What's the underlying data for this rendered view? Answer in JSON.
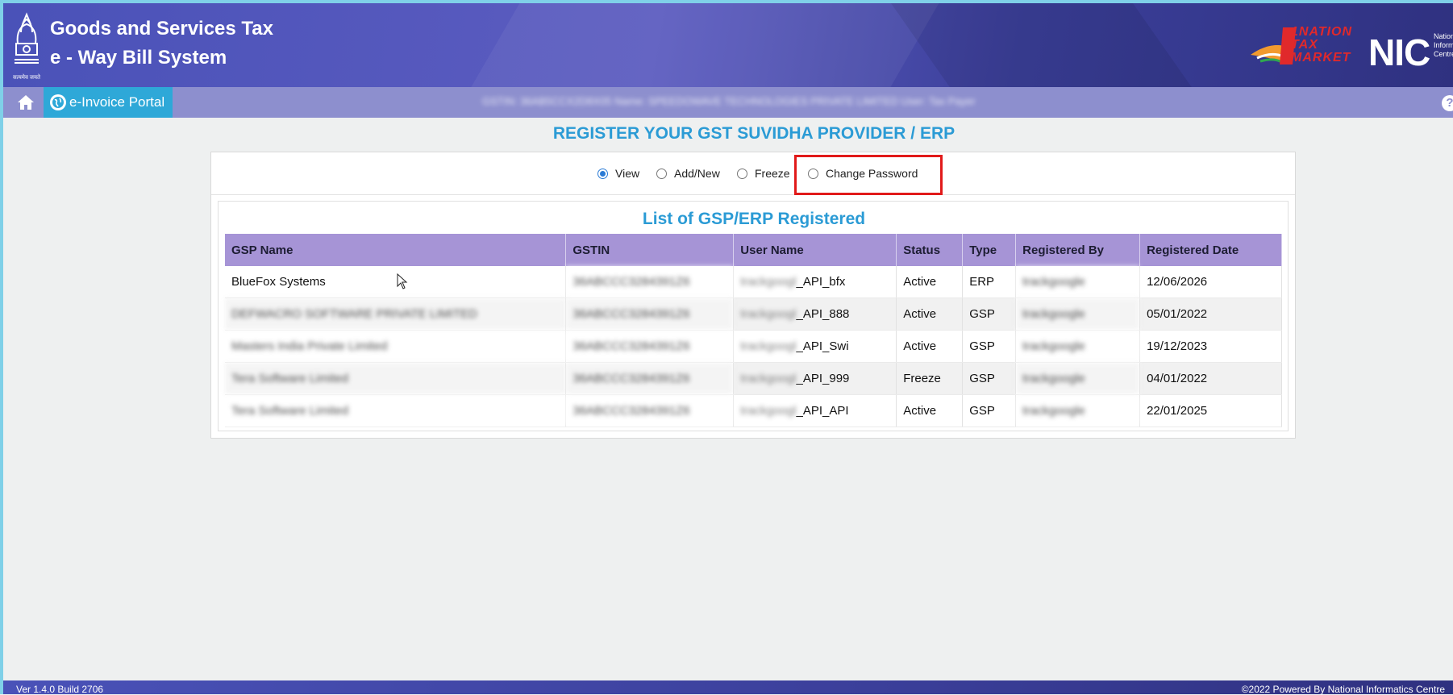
{
  "header": {
    "title_line1": "Goods and Services Tax",
    "title_line2": "e - Way Bill System",
    "emblem_caption": "सत्यमेव जयते",
    "logo_1nation": "1NATION TAX MARKET",
    "logo_nic": "NIC",
    "logo_nic_sub": "National Informatics Centre"
  },
  "nav": {
    "home_icon": "home-icon",
    "portal_label": "e-Invoice Portal",
    "user_info": "GSTIN: 36AB5CCX2D8X05 Name: SPEEDOWAVE TECHNOLOGIES PRIVATE LIMITED User: Tax Payer",
    "help_icon": "?"
  },
  "main": {
    "page_title": "REGISTER YOUR GST SUVIDHA PROVIDER / ERP",
    "options": [
      {
        "label": "View",
        "checked": true
      },
      {
        "label": "Add/New",
        "checked": false
      },
      {
        "label": "Freeze",
        "checked": false
      },
      {
        "label": "Change Password",
        "checked": false
      }
    ],
    "list_title": "List of GSP/ERP Registered",
    "columns": [
      "GSP Name",
      "GSTIN",
      "User Name",
      "Status",
      "Type",
      "Registered By",
      "Registered Date"
    ],
    "rows": [
      {
        "name": "BlueFox Systems",
        "gstin": "36ABCCC3284391Z6",
        "username_prefix": "trackgoogl",
        "username_suffix": "_API_bfx",
        "status": "Active",
        "type": "ERP",
        "registered_by": "trackgoogle",
        "date": "12/06/2026"
      },
      {
        "name": "DEFWACRO SOFTWARE PRIVATE LIMITED",
        "gstin": "36ABCCC3284391Z6",
        "username_prefix": "trackgoogl",
        "username_suffix": "_API_888",
        "status": "Active",
        "type": "GSP",
        "registered_by": "trackgoogle",
        "date": "05/01/2022"
      },
      {
        "name": "Masters India Private Limited",
        "gstin": "36ABCCC3284391Z6",
        "username_prefix": "trackgoogl",
        "username_suffix": "_API_Swi",
        "status": "Active",
        "type": "GSP",
        "registered_by": "trackgoogle",
        "date": "19/12/2023"
      },
      {
        "name": "Tera Software Limited",
        "gstin": "36ABCCC3284391Z6",
        "username_prefix": "trackgoogl",
        "username_suffix": "_API_999",
        "status": "Freeze",
        "type": "GSP",
        "registered_by": "trackgoogle",
        "date": "04/01/2022"
      },
      {
        "name": "Tera Software Limited",
        "gstin": "36ABCCC3284391Z6",
        "username_prefix": "trackgoogl",
        "username_suffix": "_API_API",
        "status": "Active",
        "type": "GSP",
        "registered_by": "trackgoogle",
        "date": "22/01/2025"
      }
    ]
  },
  "footer": {
    "version": "Ver 1.4.0 Build 2706",
    "copyright": "©2022 Powered By National Informatics Centre"
  },
  "colors": {
    "header_primary": "#4a52b8",
    "nav_bar": "#8d8fce",
    "portal_tab": "#2ea8d8",
    "title_blue": "#2b9bd5",
    "table_header": "#a694d6",
    "highlight_red": "#e11a1a"
  }
}
